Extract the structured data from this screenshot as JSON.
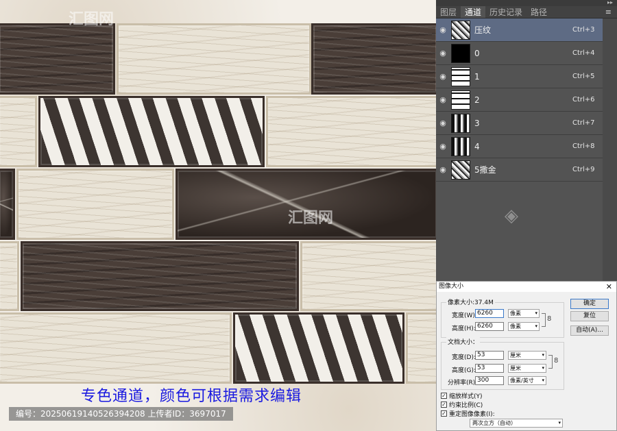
{
  "artwork": {
    "caption": "专色通道，颜色可根据需求编辑",
    "footer": "编号：20250619140526394208   上传者ID：3697017",
    "watermarks": [
      "汇图网",
      "汇图网"
    ]
  },
  "channels_panel": {
    "collapse_glyph": "▸▸",
    "tabs": [
      "图层",
      "通道",
      "历史记录",
      "路径"
    ],
    "active_tab": "通道",
    "menu_glyph": "≡",
    "rows": [
      {
        "name": "压纹",
        "shortcut": "Ctrl+3",
        "thumb": "noise",
        "selected": true
      },
      {
        "name": "0",
        "shortcut": "Ctrl+4",
        "thumb": "black",
        "selected": false
      },
      {
        "name": "1",
        "shortcut": "Ctrl+5",
        "thumb": "white",
        "selected": false
      },
      {
        "name": "2",
        "shortcut": "Ctrl+6",
        "thumb": "white",
        "selected": false
      },
      {
        "name": "3",
        "shortcut": "Ctrl+7",
        "thumb": "mixed",
        "selected": false
      },
      {
        "name": "4",
        "shortcut": "Ctrl+8",
        "thumb": "mixed",
        "selected": false
      },
      {
        "name": "5撒金",
        "shortcut": "Ctrl+9",
        "thumb": "noise",
        "selected": false
      }
    ]
  },
  "image_size_dialog": {
    "title": "图像大小",
    "close": "✕",
    "pixel_group_label": "像素大小:37.4M",
    "width_label": "宽度(W):",
    "width_value": "6260",
    "height_label": "高度(H):",
    "height_value": "6260",
    "pixel_unit": "像素",
    "doc_group_label": "文档大小：",
    "doc_width_label": "宽度(D):",
    "doc_width_value": "53",
    "doc_height_label": "高度(G):",
    "doc_height_value": "53",
    "resolution_label": "分辨率(R):",
    "resolution_value": "300",
    "cm_unit": "厘米",
    "res_unit": "像素/英寸",
    "ok_button": "确定",
    "reset_button": "复位",
    "auto_button": "自动(A)...",
    "scale_styles": "缩放样式(Y)",
    "constrain": "约束比例(C)",
    "resample": "重定图像像素(I):",
    "resample_method": "两次立方（自动）",
    "check_glyph": "✓",
    "arrow_glyph": "▾",
    "link_glyph": "8"
  }
}
